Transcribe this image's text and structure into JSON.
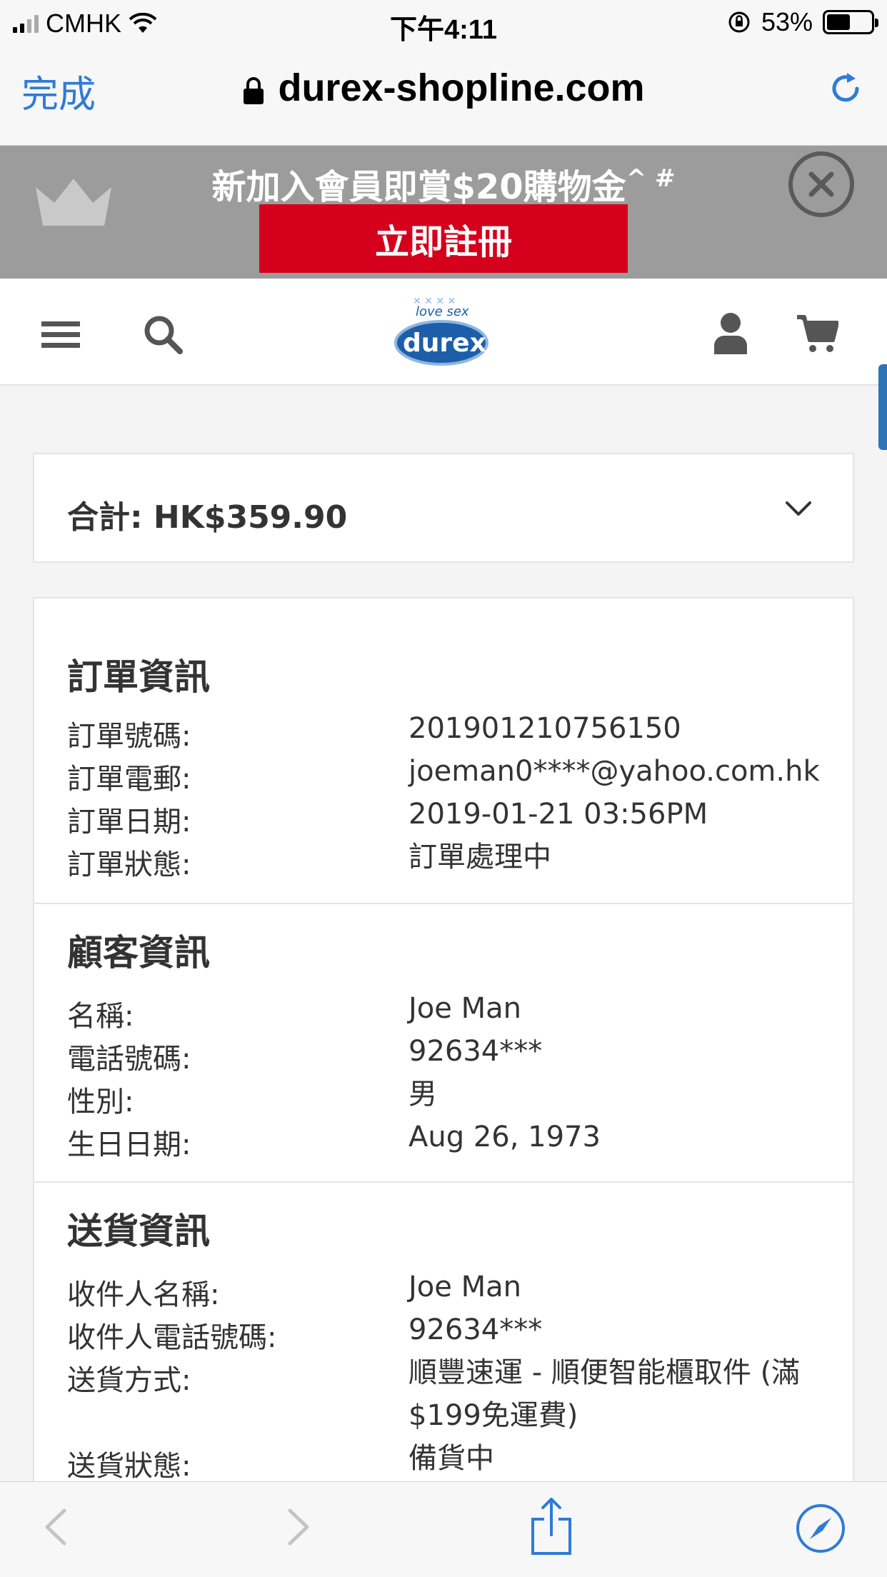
{
  "status_bar": {
    "carrier": "CMHK",
    "time": "下午4:11",
    "battery": "53%",
    "battery_level": 0.53
  },
  "browser": {
    "done_label": "完成",
    "url": "durex-shopline.com"
  },
  "promo": {
    "text": "新加入會員即賞$20購物金",
    "text_suffix": "^ #",
    "register_label": "立即註冊"
  },
  "header": {
    "logo_tagline": "love sex",
    "logo_brand": "durex"
  },
  "summary": {
    "total_label": "合計: HK$359.90"
  },
  "order_info": {
    "title": "訂單資訊",
    "rows": [
      {
        "label": "訂單號碼:",
        "value": "201901210756150"
      },
      {
        "label": "訂單電郵:",
        "value": "joeman0****@yahoo.com.hk"
      },
      {
        "label": "訂單日期:",
        "value": "2019-01-21 03:56PM"
      },
      {
        "label": "訂單狀態:",
        "value": "訂單處理中"
      }
    ]
  },
  "customer_info": {
    "title": "顧客資訊",
    "rows": [
      {
        "label": "名稱:",
        "value": "Joe Man"
      },
      {
        "label": "電話號碼:",
        "value": "92634***"
      },
      {
        "label": "性別:",
        "value": "男"
      },
      {
        "label": "生日日期:",
        "value": "Aug 26, 1973"
      }
    ]
  },
  "delivery_info": {
    "title": "送貨資訊",
    "rows": [
      {
        "label": "收件人名稱:",
        "value": "Joe Man"
      },
      {
        "label": "收件人電話號碼:",
        "value": "92634***"
      },
      {
        "label": "送貨方式:",
        "value": "順豐速運 - 順便智能櫃取件 (滿$199免運費)"
      },
      {
        "label": "送貨狀態:",
        "value": "備貨中"
      }
    ]
  },
  "colors": {
    "link_blue": "#2f7bd6",
    "banner_gray": "#9c9c9c",
    "register_red": "#d5001c",
    "durex_blue": "#1d5ea8"
  },
  "icons": {
    "menu": "hamburger-icon",
    "search": "search-icon",
    "account": "user-icon",
    "cart": "cart-icon",
    "close": "close-icon",
    "chevron": "chevron-down-icon",
    "back": "back-arrow-icon",
    "forward": "forward-arrow-icon",
    "share": "share-icon",
    "safari": "compass-icon"
  }
}
